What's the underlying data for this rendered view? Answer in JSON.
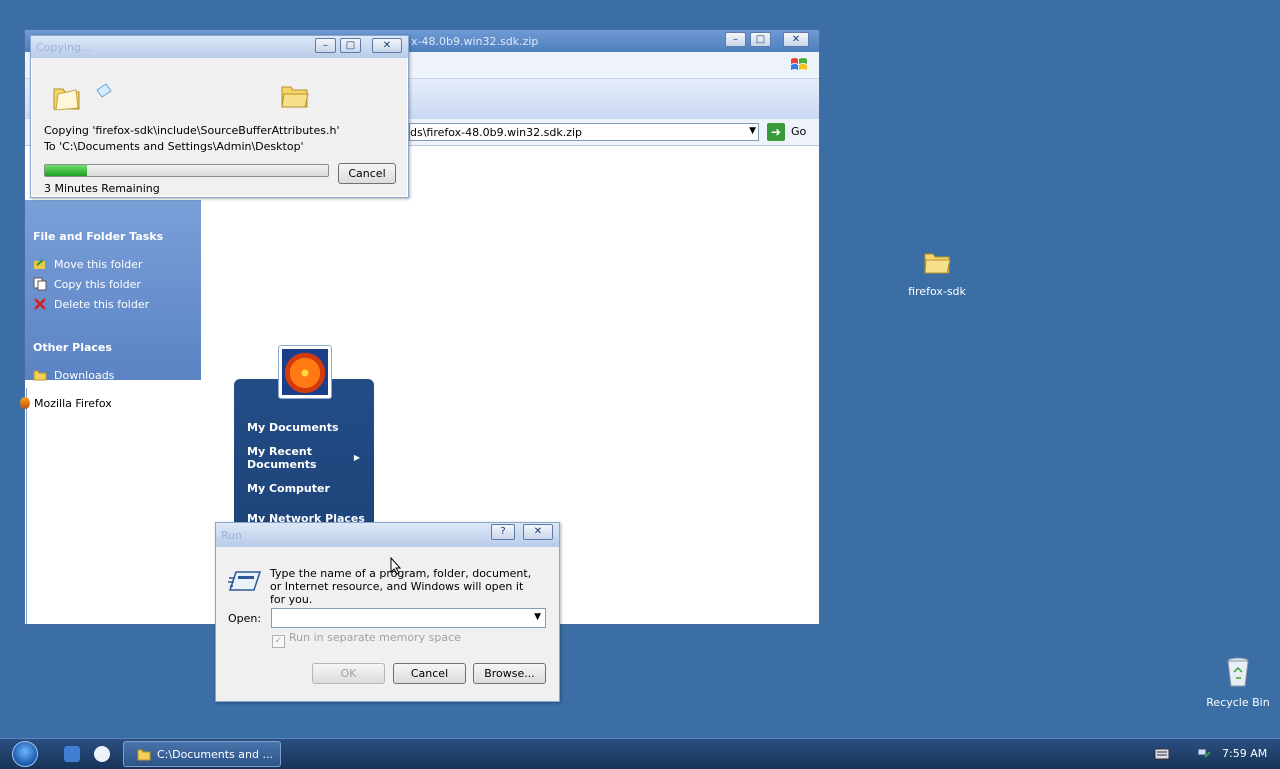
{
  "explorer": {
    "title": "x-48.0b9.win32.sdk.zip",
    "address": "ds\\firefox-48.0b9.win32.sdk.zip",
    "go_label": "Go",
    "tasks_heading": "File and Folder Tasks",
    "tasks": [
      "Move this folder",
      "Copy this folder",
      "Delete this folder"
    ],
    "other_heading": "Other Places",
    "other_items": [
      "Downloads"
    ]
  },
  "copy_dialog": {
    "title": "Copying...",
    "line1": "Copying 'firefox-sdk\\include\\SourceBufferAttributes.h'",
    "line2": "To 'C:\\Documents and Settings\\Admin\\Desktop'",
    "remaining": "3 Minutes Remaining",
    "progress": 0.15,
    "cancel_label": "Cancel"
  },
  "start_menu": {
    "pinned": [
      "Mozilla Firefox"
    ],
    "right_items": [
      "My Documents",
      "My Recent Documents",
      "My Computer",
      "My Network Places"
    ]
  },
  "run_dialog": {
    "title": "Run",
    "help_label": "?",
    "description": "Type the name of a program, folder, document, or Internet resource, and Windows will open it for you.",
    "open_label": "Open:",
    "open_value": "",
    "checkbox_label": "Run in separate memory space",
    "ok_label": "OK",
    "cancel_label": "Cancel",
    "browse_label": "Browse..."
  },
  "desktop": {
    "icons": [
      "firefox-sdk",
      "Recycle Bin"
    ]
  },
  "taskbar": {
    "task_label": "C:\\Documents and ...",
    "clock": "7:59 AM"
  },
  "colors": {
    "desktop": "#3a6ea5",
    "startmenu_right": "#1b3e73",
    "progress": "#22a022"
  }
}
